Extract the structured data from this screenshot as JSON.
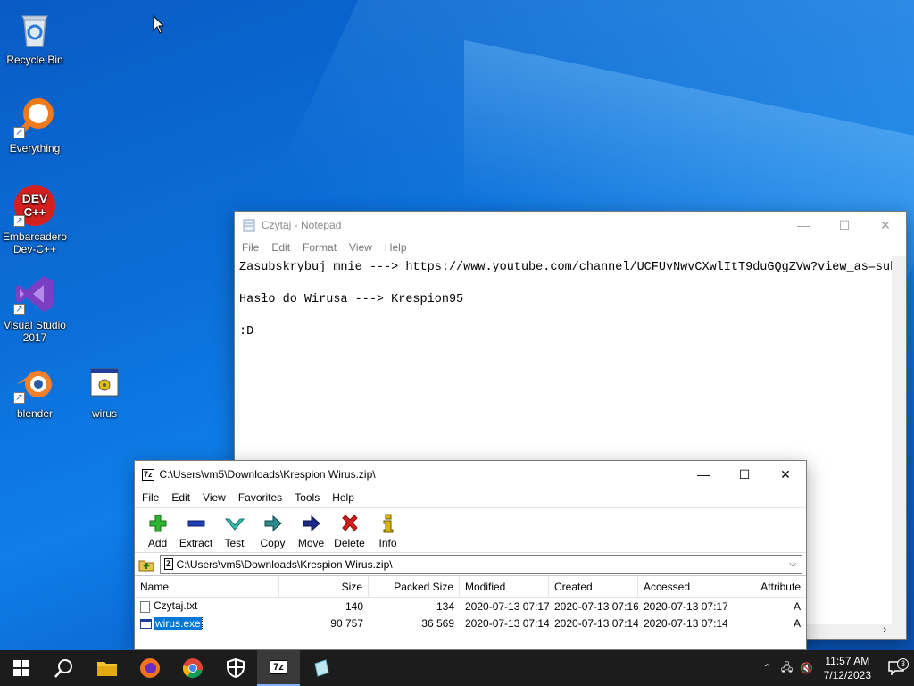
{
  "desktop": {
    "icons": [
      {
        "label": "Recycle Bin"
      },
      {
        "label": "Everything"
      },
      {
        "label": "Embarcadero Dev-C++"
      },
      {
        "label": "Visual Studio 2017"
      },
      {
        "label": "blender"
      },
      {
        "label": "wirus"
      }
    ],
    "devcpp_logo_text": "DEV C++"
  },
  "notepad": {
    "title": "Czytaj - Notepad",
    "menu": [
      "File",
      "Edit",
      "Format",
      "View",
      "Help"
    ],
    "content": "Zasubskrybuj mnie ---> https://www.youtube.com/channel/UCFUvNwvCXwlItT9duGQgZVw?view_as=sub\n\nHasło do Wirusa ---> Krespion95\n\n:D"
  },
  "sevenzip": {
    "title": "C:\\Users\\vm5\\Downloads\\Krespion Wirus.zip\\",
    "app_icon": "7z",
    "menu": [
      "File",
      "Edit",
      "View",
      "Favorites",
      "Tools",
      "Help"
    ],
    "toolbar": [
      {
        "label": "Add",
        "icon": "plus-icon",
        "color": "#2db52d"
      },
      {
        "label": "Extract",
        "icon": "minus-icon",
        "color": "#1f3fb8"
      },
      {
        "label": "Test",
        "icon": "check-icon",
        "color": "#35c4b5"
      },
      {
        "label": "Copy",
        "icon": "arrow-right-icon",
        "color": "#2a8a8a"
      },
      {
        "label": "Move",
        "icon": "arrow-right-icon",
        "color": "#1a2a8a"
      },
      {
        "label": "Delete",
        "icon": "x-icon",
        "color": "#d81c1c"
      },
      {
        "label": "Info",
        "icon": "info-icon",
        "color": "#d9b400"
      }
    ],
    "address": "C:\\Users\\vm5\\Downloads\\Krespion Wirus.zip\\",
    "columns": [
      "Name",
      "Size",
      "Packed Size",
      "Modified",
      "Created",
      "Accessed",
      "Attribute"
    ],
    "files": [
      {
        "name": "Czytaj.txt",
        "size": "140",
        "packed": "134",
        "modified": "2020-07-13 07:17",
        "created": "2020-07-13 07:16",
        "accessed": "2020-07-13 07:17",
        "attr": "A"
      },
      {
        "name": "wirus.exe",
        "size": "90 757",
        "packed": "36 569",
        "modified": "2020-07-13 07:14",
        "created": "2020-07-13 07:14",
        "accessed": "2020-07-13 07:14",
        "attr": "A"
      }
    ]
  },
  "taskbar": {
    "active_app_label": "7z",
    "time": "11:57 AM",
    "date": "7/12/2023",
    "notification_count": "3"
  }
}
